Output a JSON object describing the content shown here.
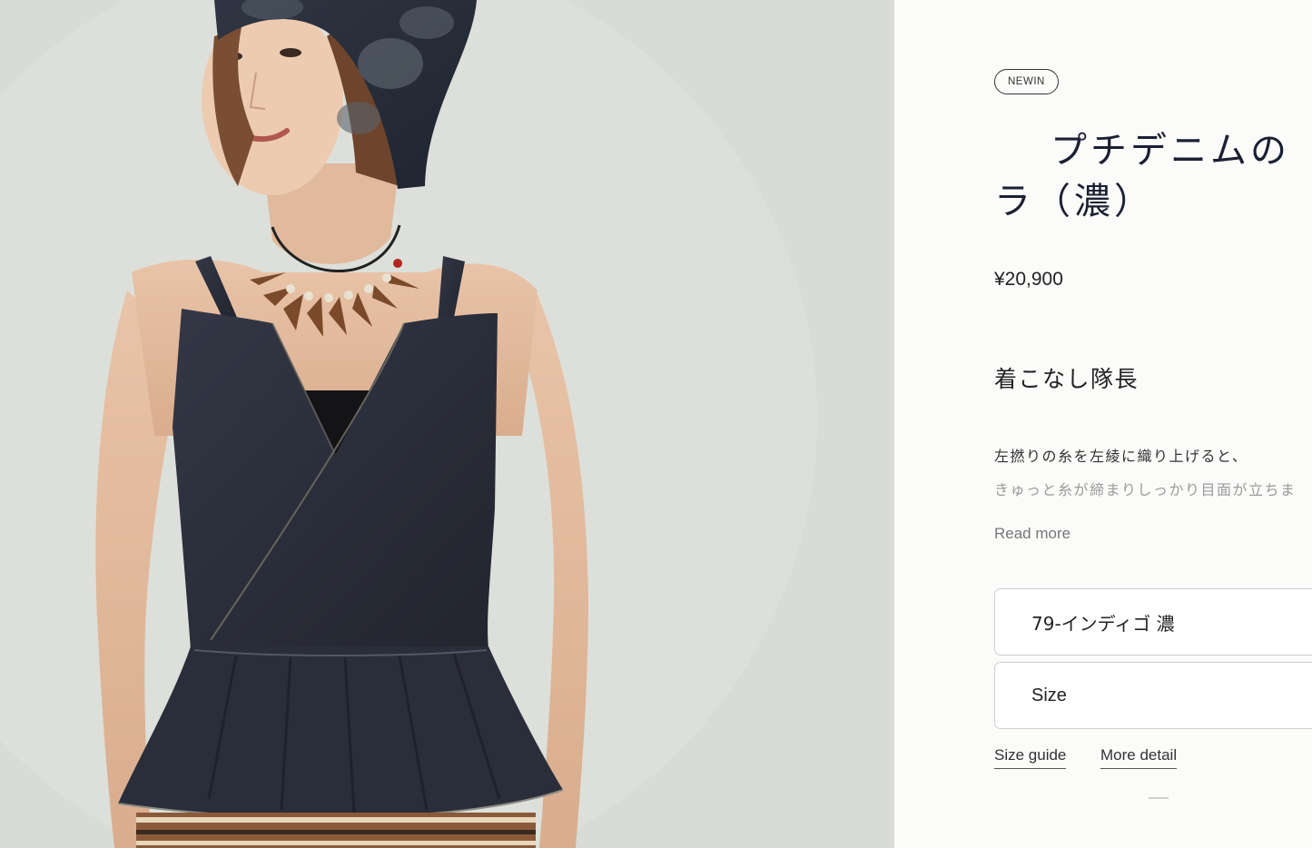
{
  "product": {
    "badge": "NEWIN",
    "title_line1": "プチデニムの",
    "title_line2": "ラ（濃）",
    "price": "¥20,900",
    "subtitle": "着こなし隊長",
    "description_line1": "左撚りの糸を左綾に織り上げると、",
    "description_line2": "きゅっと糸が締まりしっかり目面が立ちま",
    "read_more": "Read more",
    "color_selected": "79-インディゴ 濃",
    "size_placeholder": "Size",
    "size_guide": "Size guide",
    "more_detail": "More detail"
  },
  "colors": {
    "background_photo": "#d9dcd6",
    "panel_bg": "#fbfbf9",
    "title": "#1b2033",
    "denim": "#2b2f3a"
  }
}
